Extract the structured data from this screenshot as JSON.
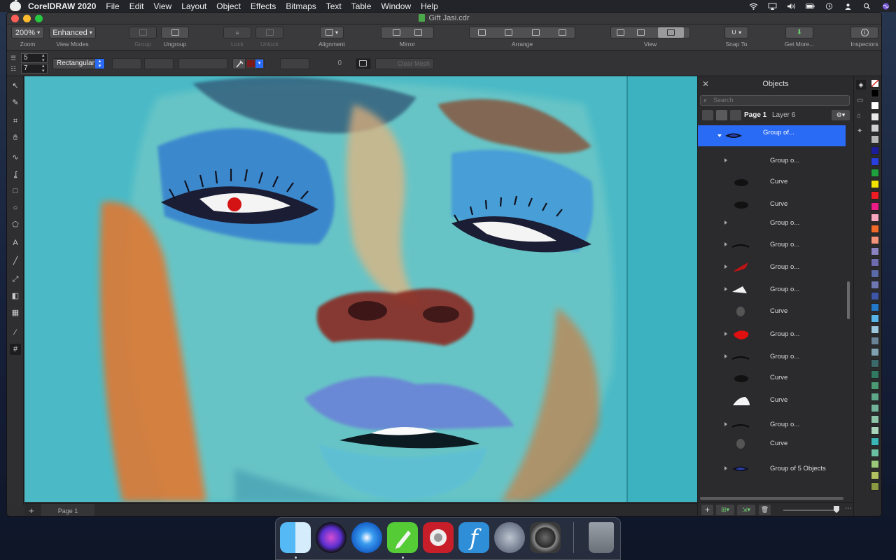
{
  "menubar": {
    "app_name": "CorelDRAW 2020",
    "items": [
      "File",
      "Edit",
      "View",
      "Layout",
      "Object",
      "Effects",
      "Bitmaps",
      "Text",
      "Table",
      "Window",
      "Help"
    ]
  },
  "window": {
    "title": "Gift Jasi.cdr"
  },
  "toolbar": {
    "zoom_value": "200%",
    "zoom_label": "Zoom",
    "view_mode_value": "Enhanced",
    "view_mode_label": "View Modes",
    "group_label": "Group",
    "ungroup_label": "Ungroup",
    "lock_label": "Lock",
    "unlock_label": "Unlock",
    "alignment_label": "Alignment",
    "mirror_label": "Mirror",
    "arrange_label": "Arrange",
    "view_label": "View",
    "snap_label": "Snap To",
    "get_more_label": "Get More...",
    "inspectors_label": "Inspectors"
  },
  "propbar": {
    "rows_value": "5",
    "cols_value": "7",
    "mesh_type": "Rectangular",
    "opacity_value": "0",
    "clear_mesh_label": "Clear Mesh"
  },
  "statusbar": {
    "page_tab": "Page 1"
  },
  "objects_panel": {
    "title": "Objects",
    "search_placeholder": "Search",
    "page_name": "Page 1",
    "layer_name": "Layer 6",
    "rows": [
      {
        "label": "Group of...",
        "selected": true,
        "expanded": true,
        "thumb": "eye-thumb"
      },
      {
        "label": "Group o...",
        "expander": true,
        "thumb": "none"
      },
      {
        "label": "Curve",
        "thumb": "dark-blob"
      },
      {
        "label": "Curve",
        "thumb": "dark-blob"
      },
      {
        "label": "Group o...",
        "expander": true,
        "thumb": "none"
      },
      {
        "label": "Group o...",
        "expander": true,
        "thumb": "lash-thumb"
      },
      {
        "label": "Group o...",
        "expander": true,
        "thumb": "red-stroke"
      },
      {
        "label": "Group o...",
        "expander": true,
        "thumb": "white-shape"
      },
      {
        "label": "Curve",
        "thumb": "grey-blob"
      },
      {
        "label": "Group o...",
        "expander": true,
        "thumb": "red-blob"
      },
      {
        "label": "Group o...",
        "expander": true,
        "thumb": "lash-thumb"
      },
      {
        "label": "Curve",
        "thumb": "dark-blob"
      },
      {
        "label": "Curve",
        "thumb": "white-blob"
      },
      {
        "label": "Group o...",
        "expander": true,
        "thumb": "lash-thumb"
      },
      {
        "label": "Curve",
        "thumb": "grey-blob"
      },
      {
        "label": "Group of 5 Objects",
        "expander": true,
        "thumb": "eye-thumb"
      }
    ]
  },
  "palette": {
    "colors": [
      "#ffffff",
      "#e9e9e9",
      "#d0d0d0",
      "#b5b5b5",
      "#1d1d9a",
      "#2a3fe0",
      "#1ea03c",
      "#f2e200",
      "#ef1c24",
      "#ec1c86",
      "#f7a8bf",
      "#f26a2a",
      "#f5927a",
      "#8a82c2",
      "#6e6bb0",
      "#5b6aa8",
      "#6f77b2",
      "#3d56a8",
      "#2478c8",
      "#58b4e8",
      "#9cc6dc",
      "#6a8296",
      "#7fa0b0",
      "#3c6a6a",
      "#2f7a60",
      "#4a9a74",
      "#5ea88a",
      "#72b49a",
      "#8cc4a8",
      "#a8d4bc",
      "#3bb6b6",
      "#6ac0a0",
      "#98c878",
      "#b0c060",
      "#8a9a40"
    ]
  },
  "dock": {
    "apps": [
      "finder",
      "siri",
      "safari",
      "coreldraw",
      "photo-booth",
      "font-app",
      "launchpad",
      "system-preferences",
      "trash"
    ]
  }
}
